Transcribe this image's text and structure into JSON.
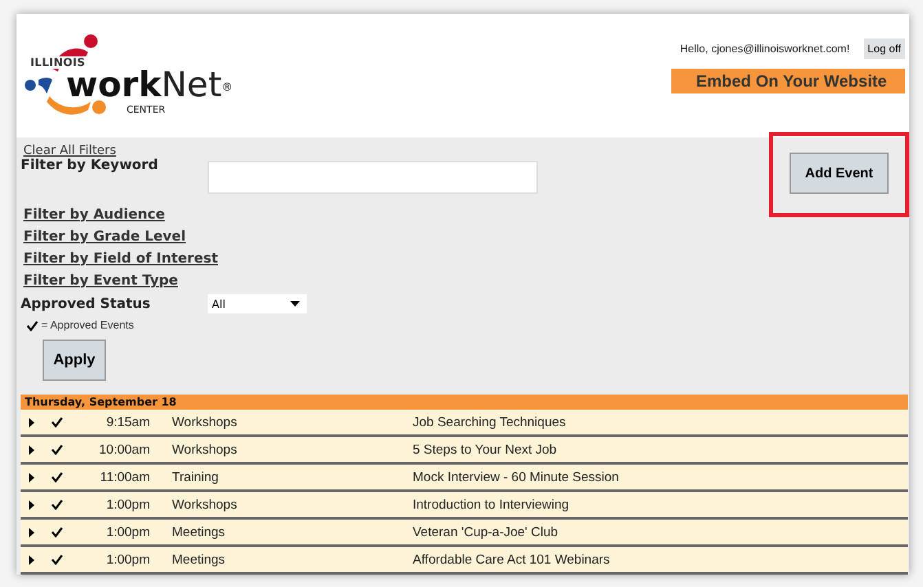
{
  "logo": {
    "state": "ILLINOIS",
    "brand_bold": "work",
    "brand_light": "Net",
    "mark": "®",
    "subtitle": "CENTER"
  },
  "user_bar": {
    "greeting": "Hello, cjones@illinoisworknet.com!",
    "logoff": "Log off"
  },
  "embed_button": "Embed On Your Website",
  "filters": {
    "clear": "Clear All Filters",
    "keyword_label": "Filter by Keyword",
    "links": [
      "Filter by Audience",
      "Filter by Grade Level",
      "Filter by Field of Interest",
      "Filter by Event Type"
    ],
    "status_label": "Approved Status",
    "status_value": "All",
    "legend": "= Approved Events",
    "apply": "Apply"
  },
  "add_event": {
    "label": "Add Event",
    "highlighted": true
  },
  "day": {
    "heading": "Thursday,  September 18",
    "events": [
      {
        "time": "9:15am",
        "category": "Workshops",
        "title": "Job Searching Techniques",
        "approved": true
      },
      {
        "time": "10:00am",
        "category": "Workshops",
        "title": "5 Steps to Your Next Job",
        "approved": true
      },
      {
        "time": "11:00am",
        "category": "Training",
        "title": "Mock Interview - 60 Minute Session",
        "approved": true
      },
      {
        "time": "1:00pm",
        "category": "Workshops",
        "title": "Introduction to Interviewing",
        "approved": true
      },
      {
        "time": "1:00pm",
        "category": "Meetings",
        "title": "Veteran 'Cup-a-Joe' Club",
        "approved": true
      },
      {
        "time": "1:00pm",
        "category": "Meetings",
        "title": "Affordable Care Act 101 Webinars",
        "approved": true
      }
    ]
  }
}
